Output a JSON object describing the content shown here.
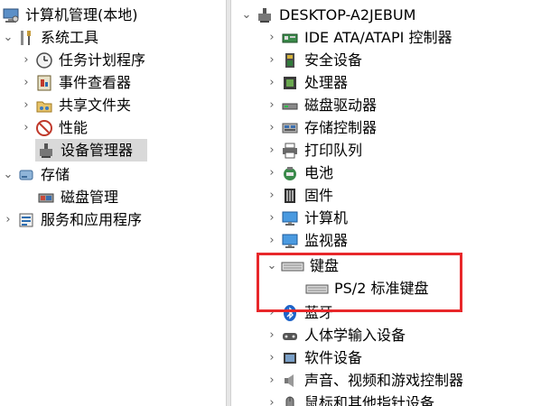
{
  "left_tree": {
    "root": "计算机管理(本地)",
    "system_tools": "系统工具",
    "task_scheduler": "任务计划程序",
    "event_viewer": "事件查看器",
    "shared_folders": "共享文件夹",
    "performance": "性能",
    "device_manager": "设备管理器",
    "storage": "存储",
    "disk_management": "磁盘管理",
    "services_apps": "服务和应用程序"
  },
  "device_tree": {
    "computer_name": "DESKTOP-A2JEBUM",
    "categories": [
      "IDE ATA/ATAPI 控制器",
      "安全设备",
      "处理器",
      "磁盘驱动器",
      "存储控制器",
      "打印队列",
      "电池",
      "固件",
      "计算机",
      "监视器",
      "键盘",
      "PS/2 标准键盘",
      "蓝牙",
      "人体学输入设备",
      "软件设备",
      "声音、视频和游戏控制器",
      "鼠标和其他指针设备"
    ]
  },
  "colors": {
    "highlight_border": "#e8272a",
    "selection_bg": "#d9d9d9"
  }
}
